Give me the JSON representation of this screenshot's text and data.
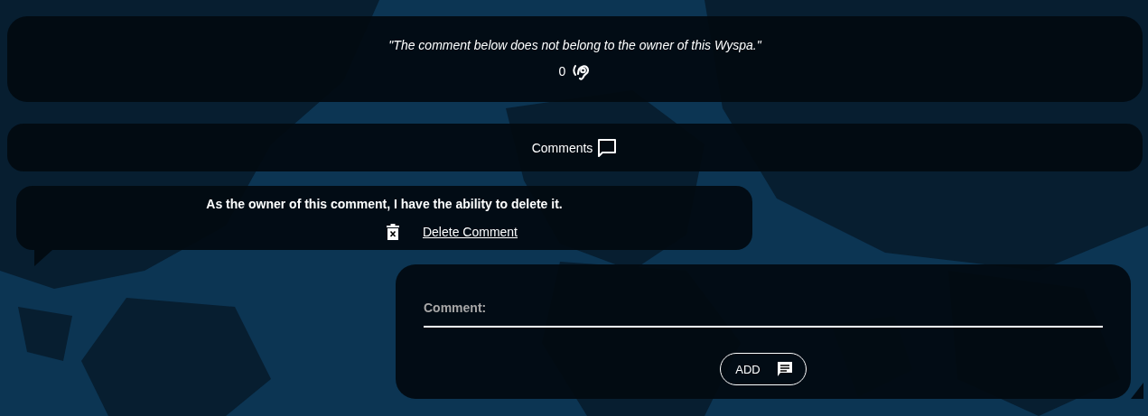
{
  "post": {
    "quote": "\"The comment below does not belong to the owner of this Wyspa.\"",
    "listen_count": "0"
  },
  "comments_header": {
    "label": "Comments"
  },
  "comment": {
    "text": "As the owner of this comment, I have the ability to delete it.",
    "delete_label": "Delete Comment"
  },
  "form": {
    "placeholder": "Comment:",
    "button": "ADD"
  }
}
